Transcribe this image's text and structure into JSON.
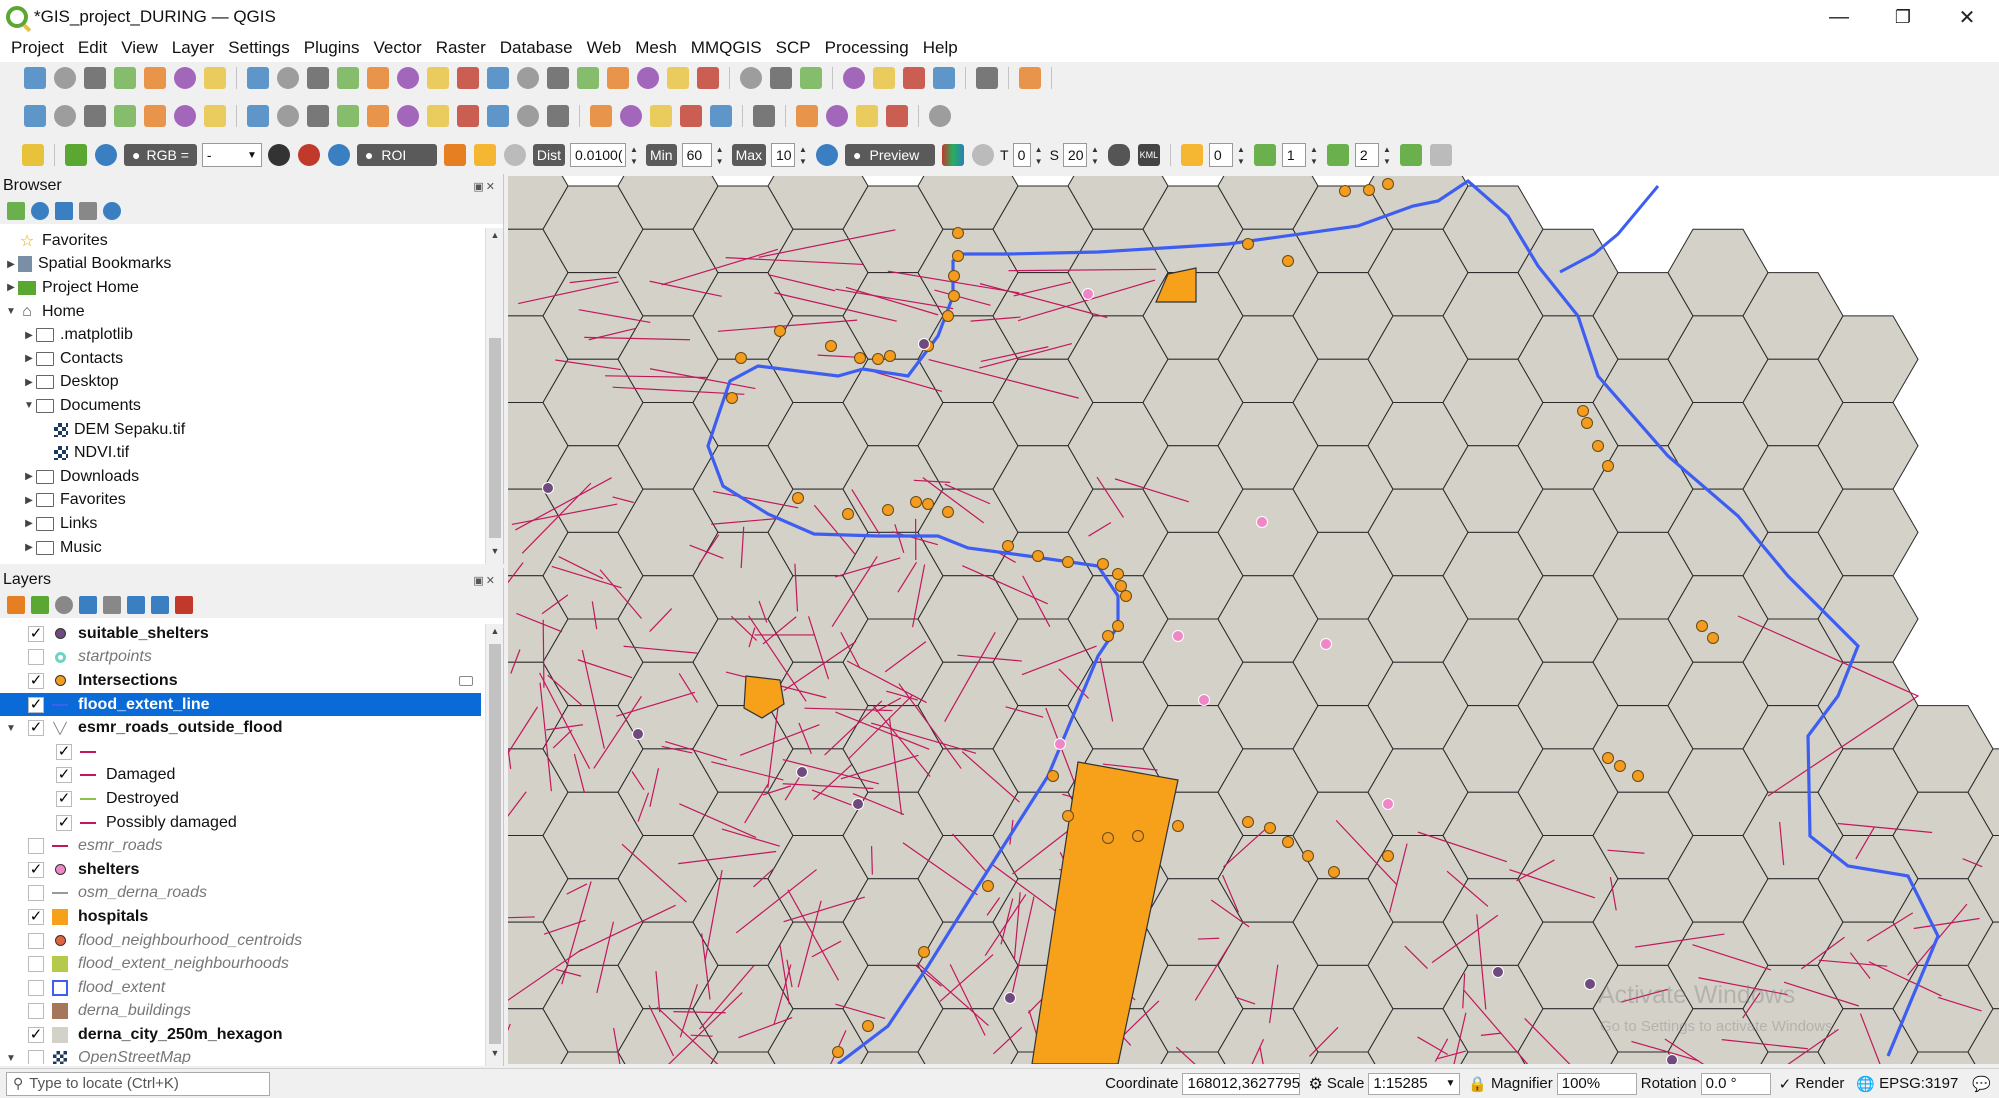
{
  "window": {
    "title": "*GIS_project_DURING — QGIS",
    "controls": [
      "—",
      "❐",
      "✕"
    ]
  },
  "menu": [
    "Project",
    "Edit",
    "View",
    "Layer",
    "Settings",
    "Plugins",
    "Vector",
    "Raster",
    "Database",
    "Web",
    "Mesh",
    "MMQGIS",
    "SCP",
    "Processing",
    "Help"
  ],
  "scp_toolbar": {
    "rgb_label": "RGB =",
    "rgb_value": "-",
    "roi_label": "ROI",
    "dist_label": "Dist",
    "dist_value": "0.0100(",
    "min_label": "Min",
    "min_value": "60",
    "max_label": "Max",
    "max_value": "10",
    "preview_label": "Preview",
    "t_label": "T",
    "t_value": "0",
    "s_label": "S",
    "s_value": "20",
    "kml_label": "KML",
    "band1": "0",
    "band2": "1",
    "band3": "2"
  },
  "browser": {
    "title": "Browser",
    "items": [
      {
        "label": "Favorites",
        "icon": "star-icon",
        "indent": 0,
        "arrow": ""
      },
      {
        "label": "Spatial Bookmarks",
        "icon": "bookmark-icon",
        "indent": 0,
        "arrow": "▶"
      },
      {
        "label": "Project Home",
        "icon": "project-home-icon",
        "indent": 0,
        "arrow": "▶"
      },
      {
        "label": "Home",
        "icon": "home-folder-icon",
        "indent": 0,
        "arrow": "▼"
      },
      {
        "label": ".matplotlib",
        "icon": "folder-icon",
        "indent": 1,
        "arrow": "▶"
      },
      {
        "label": "Contacts",
        "icon": "folder-icon",
        "indent": 1,
        "arrow": "▶"
      },
      {
        "label": "Desktop",
        "icon": "folder-icon",
        "indent": 1,
        "arrow": "▶"
      },
      {
        "label": "Documents",
        "icon": "folder-icon",
        "indent": 1,
        "arrow": "▼"
      },
      {
        "label": "DEM Sepaku.tif",
        "icon": "raster-icon",
        "indent": 2,
        "arrow": ""
      },
      {
        "label": "NDVI.tif",
        "icon": "raster-icon",
        "indent": 2,
        "arrow": ""
      },
      {
        "label": "Downloads",
        "icon": "folder-icon",
        "indent": 1,
        "arrow": "▶"
      },
      {
        "label": "Favorites",
        "icon": "folder-icon",
        "indent": 1,
        "arrow": "▶"
      },
      {
        "label": "Links",
        "icon": "folder-icon",
        "indent": 1,
        "arrow": "▶"
      },
      {
        "label": "Music",
        "icon": "folder-icon",
        "indent": 1,
        "arrow": "▶"
      }
    ]
  },
  "layers": {
    "title": "Layers",
    "items": [
      {
        "label": "suitable_shelters",
        "checked": true,
        "style": "bold",
        "symbol": "dot",
        "color": "#6e4a7e",
        "indent": 0,
        "arrow": ""
      },
      {
        "label": "startpoints",
        "checked": false,
        "style": "ital",
        "symbol": "dot-ring",
        "color": "#6fd3c4",
        "indent": 0,
        "arrow": ""
      },
      {
        "label": "Intersections",
        "checked": true,
        "style": "bold",
        "symbol": "dot",
        "color": "#f39c1f",
        "indent": 0,
        "arrow": ""
      },
      {
        "label": "flood_extent_line",
        "checked": true,
        "style": "bold",
        "symbol": "line",
        "color": "#3d5ef0",
        "indent": 0,
        "arrow": "",
        "selected": true
      },
      {
        "label": "esmr_roads_outside_flood",
        "checked": true,
        "style": "bold",
        "symbol": "rule",
        "color": "#888888",
        "indent": 0,
        "arrow": "▼"
      },
      {
        "label": "",
        "checked": true,
        "style": "",
        "symbol": "line",
        "color": "#c2185b",
        "indent": 1,
        "arrow": ""
      },
      {
        "label": "Damaged",
        "checked": true,
        "style": "",
        "symbol": "line",
        "color": "#c2185b",
        "indent": 1,
        "arrow": ""
      },
      {
        "label": "Destroyed",
        "checked": true,
        "style": "",
        "symbol": "line",
        "color": "#8bc34a",
        "indent": 1,
        "arrow": ""
      },
      {
        "label": "Possibly damaged",
        "checked": true,
        "style": "",
        "symbol": "line",
        "color": "#c2185b",
        "indent": 1,
        "arrow": ""
      },
      {
        "label": "esmr_roads",
        "checked": false,
        "style": "ital",
        "symbol": "line",
        "color": "#c2185b",
        "indent": 0,
        "arrow": ""
      },
      {
        "label": "shelters",
        "checked": true,
        "style": "bold",
        "symbol": "dot",
        "color": "#ef86c8",
        "indent": 0,
        "arrow": ""
      },
      {
        "label": "osm_derna_roads",
        "checked": false,
        "style": "ital",
        "symbol": "line",
        "color": "#999999",
        "indent": 0,
        "arrow": ""
      },
      {
        "label": "hospitals",
        "checked": true,
        "style": "bold",
        "symbol": "square",
        "color": "#f7a11a",
        "indent": 0,
        "arrow": ""
      },
      {
        "label": "flood_neighbourhood_centroids",
        "checked": false,
        "style": "ital",
        "symbol": "dot",
        "color": "#e0643c",
        "indent": 0,
        "arrow": ""
      },
      {
        "label": "flood_extent_neighbourhoods",
        "checked": false,
        "style": "ital",
        "symbol": "square",
        "color": "#b5c94a",
        "indent": 0,
        "arrow": ""
      },
      {
        "label": "flood_extent",
        "checked": false,
        "style": "ital",
        "symbol": "square-outline",
        "color": "#3d5ef0",
        "indent": 0,
        "arrow": ""
      },
      {
        "label": "derna_buildings",
        "checked": false,
        "style": "ital",
        "symbol": "square",
        "color": "#a5765a",
        "indent": 0,
        "arrow": ""
      },
      {
        "label": "derna_city_250m_hexagon",
        "checked": true,
        "style": "bold",
        "symbol": "square",
        "color": "#d4d1c9",
        "indent": 0,
        "arrow": ""
      },
      {
        "label": "OpenStreetMap",
        "checked": false,
        "style": "ital",
        "symbol": "raster",
        "color": "#555555",
        "indent": 0,
        "arrow": "▼"
      }
    ]
  },
  "map": {
    "hex_fill": "#d4d1c9",
    "hex_stroke": "#2a2a2a",
    "road_color": "#c2185b",
    "flood_line_color": "#3d5ef0",
    "intersection_color": "#f39c1f",
    "shelter_color": "#ef86c8",
    "suitable_color": "#6e4a7e",
    "hospital_color": "#f7a11a",
    "watermark_title": "Activate Windows",
    "watermark_sub": "Go to Settings to activate Windows."
  },
  "status": {
    "locate_placeholder": "Type to locate (Ctrl+K)",
    "coordinate_label": "Coordinate",
    "coordinate_value": "168012,3627795",
    "scale_label": "Scale",
    "scale_value": "1:15285",
    "magnifier_label": "Magnifier",
    "magnifier_value": "100%",
    "rotation_label": "Rotation",
    "rotation_value": "0.0 °",
    "render_label": "Render",
    "crs_label": "EPSG:3197"
  }
}
